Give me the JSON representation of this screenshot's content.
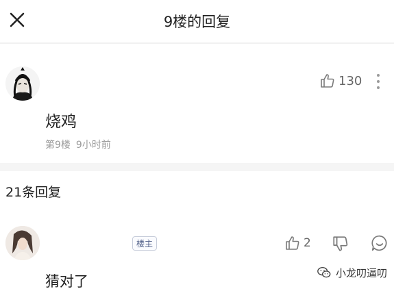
{
  "header": {
    "title": "9楼的回复",
    "close_icon": "close-icon"
  },
  "main_comment": {
    "avatar_icon": "warrior-avatar",
    "likes": "130",
    "text": "烧鸡",
    "floor": "第9楼",
    "time": "9小时前"
  },
  "replies_header": "21条回复",
  "reply": {
    "avatar_icon": "girl-avatar",
    "badge": "楼主",
    "likes": "2",
    "text": "猜对了"
  },
  "watermark": {
    "text": "小龙叨逼叨",
    "icon": "wechat-icon"
  },
  "colors": {
    "text": "#1f1f1f",
    "muted": "#9a9a9a",
    "icon": "#7a7a7a",
    "badge": "#4b5b85"
  }
}
